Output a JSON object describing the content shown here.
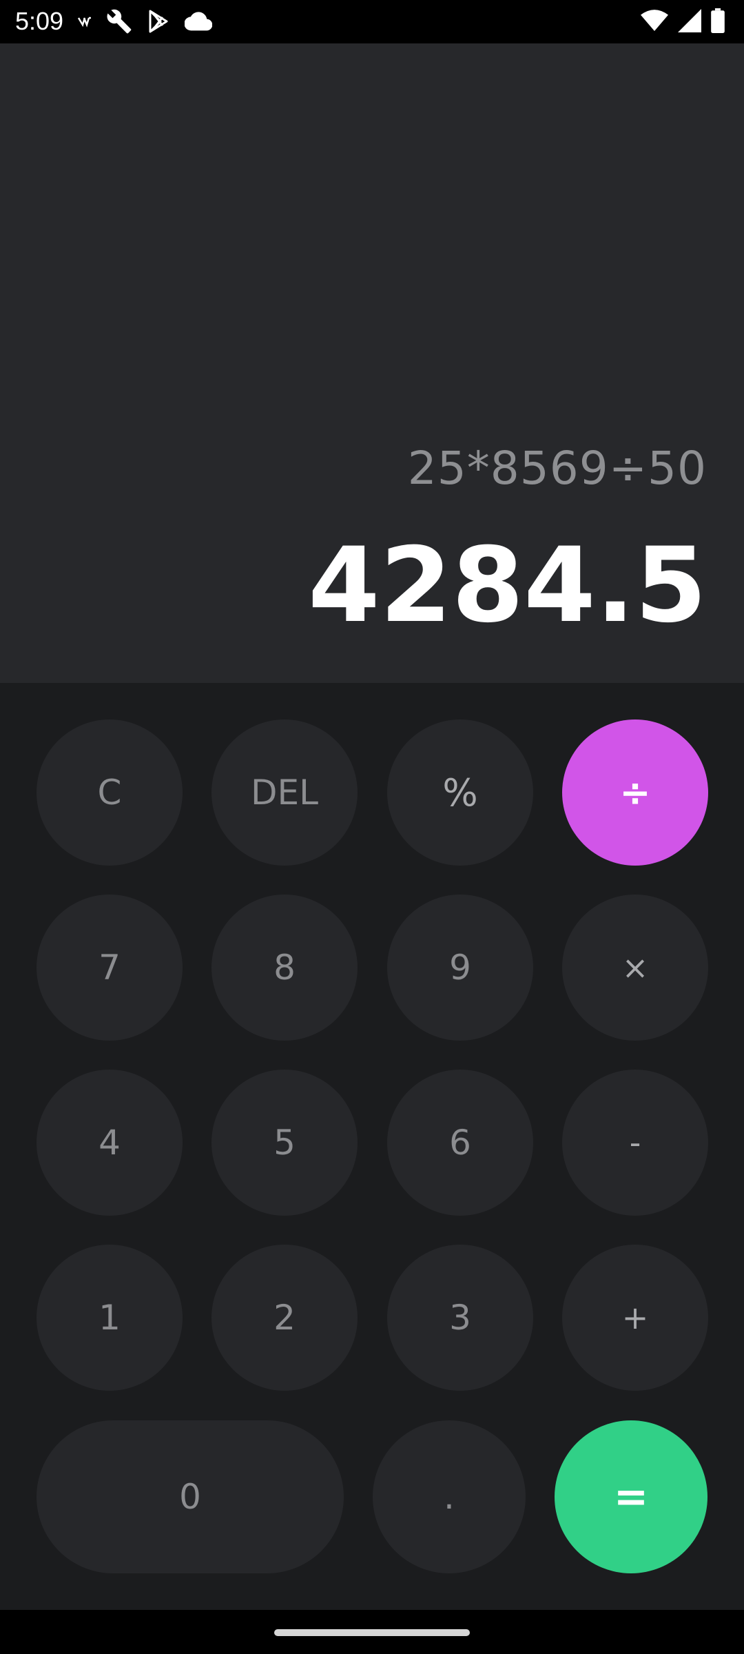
{
  "status_bar": {
    "time": "5:09",
    "left_icons": [
      "signal-small-icon",
      "wrench-icon",
      "play-store-icon",
      "cloud-icon"
    ],
    "right_icons": [
      "wifi-icon",
      "cellular-icon",
      "battery-icon"
    ]
  },
  "display": {
    "expression": "25*8569÷50",
    "result": "4284.5"
  },
  "keys": {
    "clear": "C",
    "delete": "DEL",
    "percent": "%",
    "divide": "÷",
    "seven": "7",
    "eight": "8",
    "nine": "9",
    "multiply": "×",
    "four": "4",
    "five": "5",
    "six": "6",
    "minus": "-",
    "one": "1",
    "two": "2",
    "three": "3",
    "plus": "+",
    "zero": "0",
    "dot": ".",
    "equals": "="
  },
  "colors": {
    "display_bg": "#27282b",
    "keypad_bg": "#1b1c1e",
    "key_bg": "#26272a",
    "divide_accent": "#d155e8",
    "equals_accent": "#31d087"
  }
}
